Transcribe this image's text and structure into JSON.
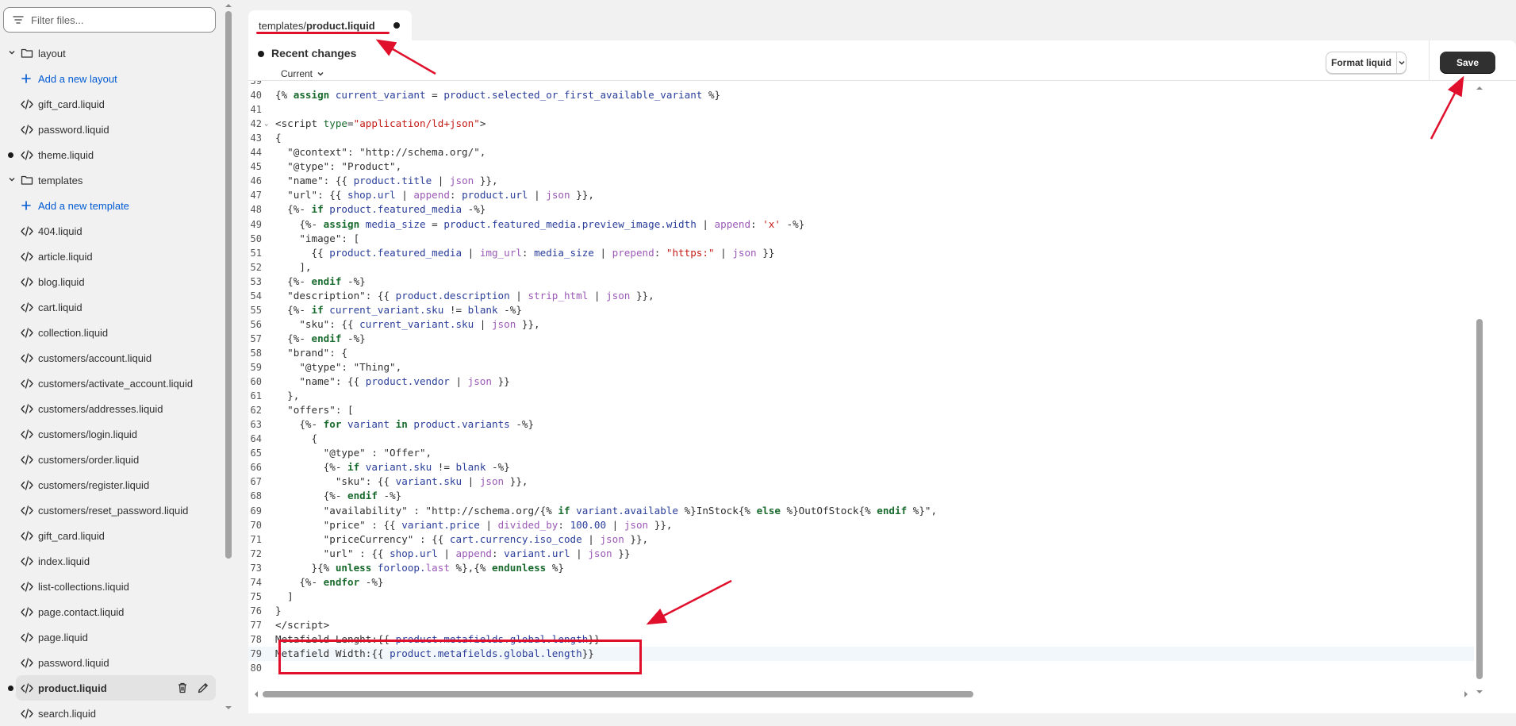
{
  "sidebar": {
    "filter_placeholder": "Filter files...",
    "items": [
      {
        "type": "folder",
        "label": "layout"
      },
      {
        "type": "add",
        "label": "Add a new layout"
      },
      {
        "type": "file",
        "label": "gift_card.liquid"
      },
      {
        "type": "file",
        "label": "password.liquid"
      },
      {
        "type": "file",
        "label": "theme.liquid",
        "modified": true
      },
      {
        "type": "folder",
        "label": "templates"
      },
      {
        "type": "add",
        "label": "Add a new template"
      },
      {
        "type": "file",
        "label": "404.liquid"
      },
      {
        "type": "file",
        "label": "article.liquid"
      },
      {
        "type": "file",
        "label": "blog.liquid"
      },
      {
        "type": "file",
        "label": "cart.liquid"
      },
      {
        "type": "file",
        "label": "collection.liquid"
      },
      {
        "type": "file",
        "label": "customers/account.liquid"
      },
      {
        "type": "file",
        "label": "customers/activate_account.liquid"
      },
      {
        "type": "file",
        "label": "customers/addresses.liquid"
      },
      {
        "type": "file",
        "label": "customers/login.liquid"
      },
      {
        "type": "file",
        "label": "customers/order.liquid"
      },
      {
        "type": "file",
        "label": "customers/register.liquid"
      },
      {
        "type": "file",
        "label": "customers/reset_password.liquid"
      },
      {
        "type": "file",
        "label": "gift_card.liquid"
      },
      {
        "type": "file",
        "label": "index.liquid"
      },
      {
        "type": "file",
        "label": "list-collections.liquid"
      },
      {
        "type": "file",
        "label": "page.contact.liquid"
      },
      {
        "type": "file",
        "label": "page.liquid"
      },
      {
        "type": "file",
        "label": "password.liquid"
      },
      {
        "type": "file",
        "label": "product.liquid",
        "modified": true,
        "active": true
      },
      {
        "type": "file",
        "label": "search.liquid"
      }
    ]
  },
  "tab": {
    "path": "templates/",
    "file": "product.liquid"
  },
  "header": {
    "recent_changes": "Recent changes",
    "current": "Current",
    "format_label": "Format liquid",
    "save_label": "Save"
  },
  "editor": {
    "highlighted_line": 79,
    "lines": [
      {
        "n": "39",
        "html": ""
      },
      {
        "n": "40",
        "html": "<span class='p'>{% </span><span class='k'>assign</span><span class='v'> current_variant</span><span class='p'> = </span><span class='v'>product.selected_or_first_available_variant</span><span class='p'> %}</span>"
      },
      {
        "n": "41",
        "html": ""
      },
      {
        "n": "42",
        "fold": true,
        "html": "<span class='p'>&lt;script </span><span class='t'>type</span><span class='p'>=</span><span class='s'>\"application/ld+json\"</span><span class='p'>&gt;</span>"
      },
      {
        "n": "43",
        "html": "<span class='p'>{</span>"
      },
      {
        "n": "44",
        "html": "<span class='p'>  \"@context\": \"http://schema.org/\",</span>"
      },
      {
        "n": "45",
        "html": "<span class='p'>  \"@type\": \"Product\",</span>"
      },
      {
        "n": "46",
        "html": "<span class='p'>  \"name\": {{ </span><span class='v'>product.title</span><span class='p'> | </span><span class='f'>json</span><span class='p'> }},</span>"
      },
      {
        "n": "47",
        "html": "<span class='p'>  \"url\": {{ </span><span class='v'>shop.url</span><span class='p'> | </span><span class='f'>append</span><span class='p'>: </span><span class='v'>product.url</span><span class='p'> | </span><span class='f'>json</span><span class='p'> }},</span>"
      },
      {
        "n": "48",
        "html": "<span class='p'>  {%- </span><span class='k'>if</span><span class='v'> product.featured_media</span><span class='p'> -%}</span>"
      },
      {
        "n": "49",
        "html": "<span class='p'>    {%- </span><span class='k'>assign</span><span class='v'> media_size</span><span class='p'> = </span><span class='v'>product.featured_media.preview_image.width</span><span class='p'> | </span><span class='f'>append</span><span class='p'>: </span><span class='s'>'x'</span><span class='p'> -%}</span>"
      },
      {
        "n": "50",
        "html": "<span class='p'>    \"image\": [</span>"
      },
      {
        "n": "51",
        "html": "<span class='p'>      {{ </span><span class='v'>product.featured_media</span><span class='p'> | </span><span class='f'>img_url</span><span class='p'>: </span><span class='v'>media_size</span><span class='p'> | </span><span class='f'>prepend</span><span class='p'>: </span><span class='s'>\"https:\"</span><span class='p'> | </span><span class='f'>json</span><span class='p'> }}</span>"
      },
      {
        "n": "52",
        "html": "<span class='p'>    ],</span>"
      },
      {
        "n": "53",
        "html": "<span class='p'>  {%- </span><span class='k'>endif</span><span class='p'> -%}</span>"
      },
      {
        "n": "54",
        "html": "<span class='p'>  \"description\": {{ </span><span class='v'>product.description</span><span class='p'> | </span><span class='f'>strip_html</span><span class='p'> | </span><span class='f'>json</span><span class='p'> }},</span>"
      },
      {
        "n": "55",
        "html": "<span class='p'>  {%- </span><span class='k'>if</span><span class='v'> current_variant.sku</span><span class='p'> != </span><span class='v'>blank</span><span class='p'> -%}</span>"
      },
      {
        "n": "56",
        "html": "<span class='p'>    \"sku\": {{ </span><span class='v'>current_variant.sku</span><span class='p'> | </span><span class='f'>json</span><span class='p'> }},</span>"
      },
      {
        "n": "57",
        "html": "<span class='p'>  {%- </span><span class='k'>endif</span><span class='p'> -%}</span>"
      },
      {
        "n": "58",
        "html": "<span class='p'>  \"brand\": {</span>"
      },
      {
        "n": "59",
        "html": "<span class='p'>    \"@type\": \"Thing\",</span>"
      },
      {
        "n": "60",
        "html": "<span class='p'>    \"name\": {{ </span><span class='v'>product.vendor</span><span class='p'> | </span><span class='f'>json</span><span class='p'> }}</span>"
      },
      {
        "n": "61",
        "html": "<span class='p'>  },</span>"
      },
      {
        "n": "62",
        "html": "<span class='p'>  \"offers\": [</span>"
      },
      {
        "n": "63",
        "html": "<span class='p'>    {%- </span><span class='k'>for</span><span class='v'> variant</span><span class='k'> in</span><span class='v'> product.variants</span><span class='p'> -%}</span>"
      },
      {
        "n": "64",
        "html": "<span class='p'>      {</span>"
      },
      {
        "n": "65",
        "html": "<span class='p'>        \"@type\" : \"Offer\",</span>"
      },
      {
        "n": "66",
        "html": "<span class='p'>        {%- </span><span class='k'>if</span><span class='v'> variant.sku</span><span class='p'> != </span><span class='v'>blank</span><span class='p'> -%}</span>"
      },
      {
        "n": "67",
        "html": "<span class='p'>          \"sku\": {{ </span><span class='v'>variant.sku</span><span class='p'> | </span><span class='f'>json</span><span class='p'> }},</span>"
      },
      {
        "n": "68",
        "html": "<span class='p'>        {%- </span><span class='k'>endif</span><span class='p'> -%}</span>"
      },
      {
        "n": "69",
        "html": "<span class='p'>        \"availability\" : \"http://schema.org/{% </span><span class='k'>if</span><span class='v'> variant.available</span><span class='p'> %}InStock{% </span><span class='k'>else</span><span class='p'> %}OutOfStock{% </span><span class='k'>endif</span><span class='p'> %}\",</span>"
      },
      {
        "n": "70",
        "html": "<span class='p'>        \"price\" : {{ </span><span class='v'>variant.price</span><span class='p'> | </span><span class='f'>divided_by</span><span class='p'>: </span><span class='v'>100.00</span><span class='p'> | </span><span class='f'>json</span><span class='p'> }},</span>"
      },
      {
        "n": "71",
        "html": "<span class='p'>        \"priceCurrency\" : {{ </span><span class='v'>cart.currency.iso_code</span><span class='p'> | </span><span class='f'>json</span><span class='p'> }},</span>"
      },
      {
        "n": "72",
        "html": "<span class='p'>        \"url\" : {{ </span><span class='v'>shop.url</span><span class='p'> | </span><span class='f'>append</span><span class='p'>: </span><span class='v'>variant.url</span><span class='p'> | </span><span class='f'>json</span><span class='p'> }}</span>"
      },
      {
        "n": "73",
        "html": "<span class='p'>      }{% </span><span class='k'>unless</span><span class='v'> forloop.</span><span class='f'>last</span><span class='p'> %},{% </span><span class='k'>endunless</span><span class='p'> %}</span>"
      },
      {
        "n": "74",
        "html": "<span class='p'>    {%- </span><span class='k'>endfor</span><span class='p'> -%}</span>"
      },
      {
        "n": "75",
        "html": "<span class='p'>  ]</span>"
      },
      {
        "n": "76",
        "html": "<span class='p'>}</span>"
      },
      {
        "n": "77",
        "html": "<span class='p'>&lt;/script&gt;</span>"
      },
      {
        "n": "78",
        "html": "<span class='p'>Metafield Lenght:{{ </span><span class='v'>product.metafields.global.length</span><span class='p'>}}</span>"
      },
      {
        "n": "79",
        "html": "<span class='p'>Metafield Width:{{ </span><span class='v'>product.metafields.global.length</span><span class='p'>}}</span>"
      },
      {
        "n": "80",
        "html": ""
      }
    ]
  },
  "colors": {
    "accent_red": "#e0102c",
    "save_bg": "#303030",
    "link_blue": "#005bd3"
  }
}
